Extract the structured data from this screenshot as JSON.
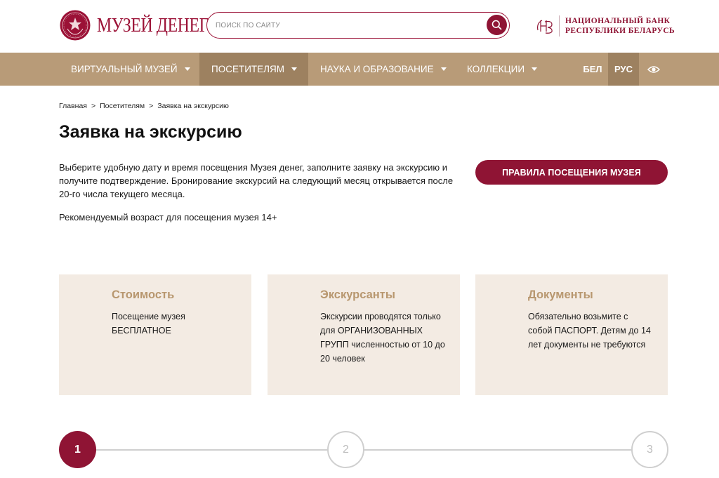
{
  "header": {
    "logo_text": "МУЗЕЙ ДЕНЕГ",
    "search_placeholder": "ПОИСК ПО САЙТУ",
    "nbrb_line1": "НАЦИОНАЛЬНЫЙ БАНК",
    "nbrb_line2": "РЕСПУБЛИКИ БЕЛАРУСЬ",
    "brand_color": "#8f1434"
  },
  "nav": {
    "items": [
      {
        "label": "ВИРТУАЛЬНЫЙ МУЗЕЙ"
      },
      {
        "label": "ПОСЕТИТЕЛЯМ"
      },
      {
        "label": "НАУКА И ОБРАЗОВАНИЕ"
      },
      {
        "label": "КОЛЛЕКЦИИ"
      }
    ],
    "active_item": "ПОСЕТИТЕЛЯМ",
    "lang_be": "БЕЛ",
    "lang_ru": "РУС",
    "active_lang": "РУС",
    "accessibility_icon": "eye-icon",
    "bg_color": "#b89b78"
  },
  "breadcrumb": {
    "items": [
      "Главная",
      "Посетителям",
      "Заявка на экскурсию"
    ],
    "separator": ">"
  },
  "main": {
    "title": "Заявка на экскурсию",
    "intro": "Выберите удобную дату и время посещения Музея денег, заполните заявку на экскурсию и получите подтверждение. Бронирование экскурсий на следующий месяц открывается после 20-го числа текущего месяца.",
    "age_note": "Рекомендуемый возраст для посещения музея 14+",
    "rules_button": "ПРАВИЛА ПОСЕЩЕНИЯ МУЗЕЯ"
  },
  "cards": [
    {
      "title": "Стоимость",
      "text": "Посещение музея БЕСПЛАТНОЕ"
    },
    {
      "title": "Экскурсанты",
      "text": "Экскурсии проводятся только для ОРГАНИЗОВАННЫХ ГРУПП численностью от 10 до 20 человек"
    },
    {
      "title": "Документы",
      "text": "Обязательно возьмите с собой ПАСПОРТ.  Детям до 14 лет документы не требуются"
    }
  ],
  "steps": {
    "labels": [
      "1",
      "2",
      "3"
    ],
    "current": "1"
  }
}
